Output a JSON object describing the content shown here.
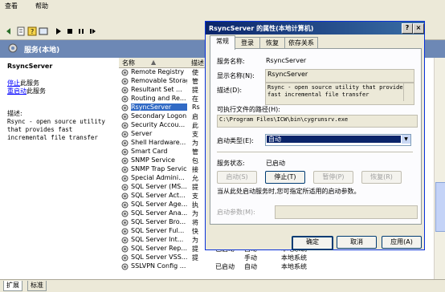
{
  "menu": {
    "view": "查看",
    "help": "帮助"
  },
  "header": {
    "title": "服务(本地)"
  },
  "left": {
    "service_name": "RsyncServer",
    "stop_link": "停止",
    "stop_suffix": "此服务",
    "restart_link": "重启动",
    "restart_suffix": "此服务",
    "desc_label": "描述:",
    "desc_text": "Rsync - open source utility that provides fast incremental file transfer"
  },
  "list": {
    "col_name": "名称",
    "col_desc": "描述",
    "rows": [
      {
        "name": "Remote Registry",
        "desc": "使"
      },
      {
        "name": "Removable Storage",
        "desc": "管"
      },
      {
        "name": "Resultant Set ...",
        "desc": "提"
      },
      {
        "name": "Routing and Re...",
        "desc": "在"
      },
      {
        "name": "RsyncServer",
        "desc": "Rs",
        "selected": true
      },
      {
        "name": "Secondary Logon",
        "desc": "启"
      },
      {
        "name": "Security Accou...",
        "desc": "此"
      },
      {
        "name": "Server",
        "desc": "支"
      },
      {
        "name": "Shell Hardware...",
        "desc": "为"
      },
      {
        "name": "Smart Card",
        "desc": "管"
      },
      {
        "name": "SNMP Service",
        "desc": "包"
      },
      {
        "name": "SNMP Trap Service",
        "desc": "接"
      },
      {
        "name": "Special Admini...",
        "desc": "允"
      },
      {
        "name": "SQL Server (MS...",
        "desc": "提"
      },
      {
        "name": "SQL Server Act...",
        "desc": "支"
      },
      {
        "name": "SQL Server Age...",
        "desc": "执"
      },
      {
        "name": "SQL Server Ana...",
        "desc": "为"
      },
      {
        "name": "SQL Server Bro...",
        "desc": "将"
      },
      {
        "name": "SQL Server Ful...",
        "desc": "快"
      },
      {
        "name": "SQL Server Int...",
        "desc": "为"
      },
      {
        "name": "SQL Server Rep...",
        "desc": "提",
        "status": "已启动",
        "start": "自动",
        "logon": "本地系统"
      },
      {
        "name": "SQL Server VSS...",
        "desc": "提",
        "status": "",
        "start": "手动",
        "logon": "本地系统"
      },
      {
        "name": "SSLVPN Config ...",
        "desc": "",
        "status": "已启动",
        "start": "自动",
        "logon": "本地系统"
      }
    ]
  },
  "bottom_tabs": {
    "extended": "扩展",
    "standard": "标准"
  },
  "dialog": {
    "title": "RsyncServer 的属性(本地计算机)",
    "help_btn": "?",
    "close_btn": "×",
    "tabs": [
      "常规",
      "登录",
      "恢复",
      "依存关系"
    ],
    "service_name_label": "服务名称:",
    "service_name": "RsyncServer",
    "display_name_label": "显示名称(N):",
    "display_name": "RsyncServer",
    "description_label": "描述(D):",
    "description": "Rsync - open source utility that provides fast incremental file transfer",
    "exe_path_label": "可执行文件的路径(H):",
    "exe_path": "C:\\Program Files\\ICW\\bin\\cygrunsrv.exe",
    "startup_type_label": "启动类型(E):",
    "startup_type": "自动",
    "status_label": "服务状态:",
    "status": "已启动",
    "start_btn": "启动(S)",
    "stop_btn": "停止(T)",
    "pause_btn": "暂停(P)",
    "resume_btn": "恢复(R)",
    "hint": "当从此处启动服务时,您可指定所适用的启动参数。",
    "params_label": "启动参数(M):",
    "ok": "确定",
    "cancel": "取消",
    "apply": "应用(A)"
  }
}
